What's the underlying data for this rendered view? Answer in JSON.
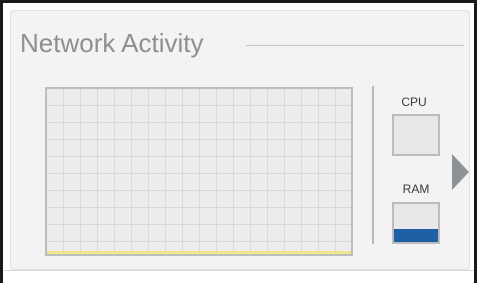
{
  "panel": {
    "title": "Network Activity"
  },
  "meters": {
    "cpu": {
      "label": "CPU",
      "fill_fraction": 0.0
    },
    "ram": {
      "label": "RAM",
      "fill_fraction": 0.35,
      "fill_color": "#1f5fa3"
    }
  },
  "colors": {
    "baseline": "#f0e68c",
    "title": "#8d8f91",
    "arrow": "#8e9296"
  },
  "icons": {
    "expand": "chevron-right-icon"
  }
}
